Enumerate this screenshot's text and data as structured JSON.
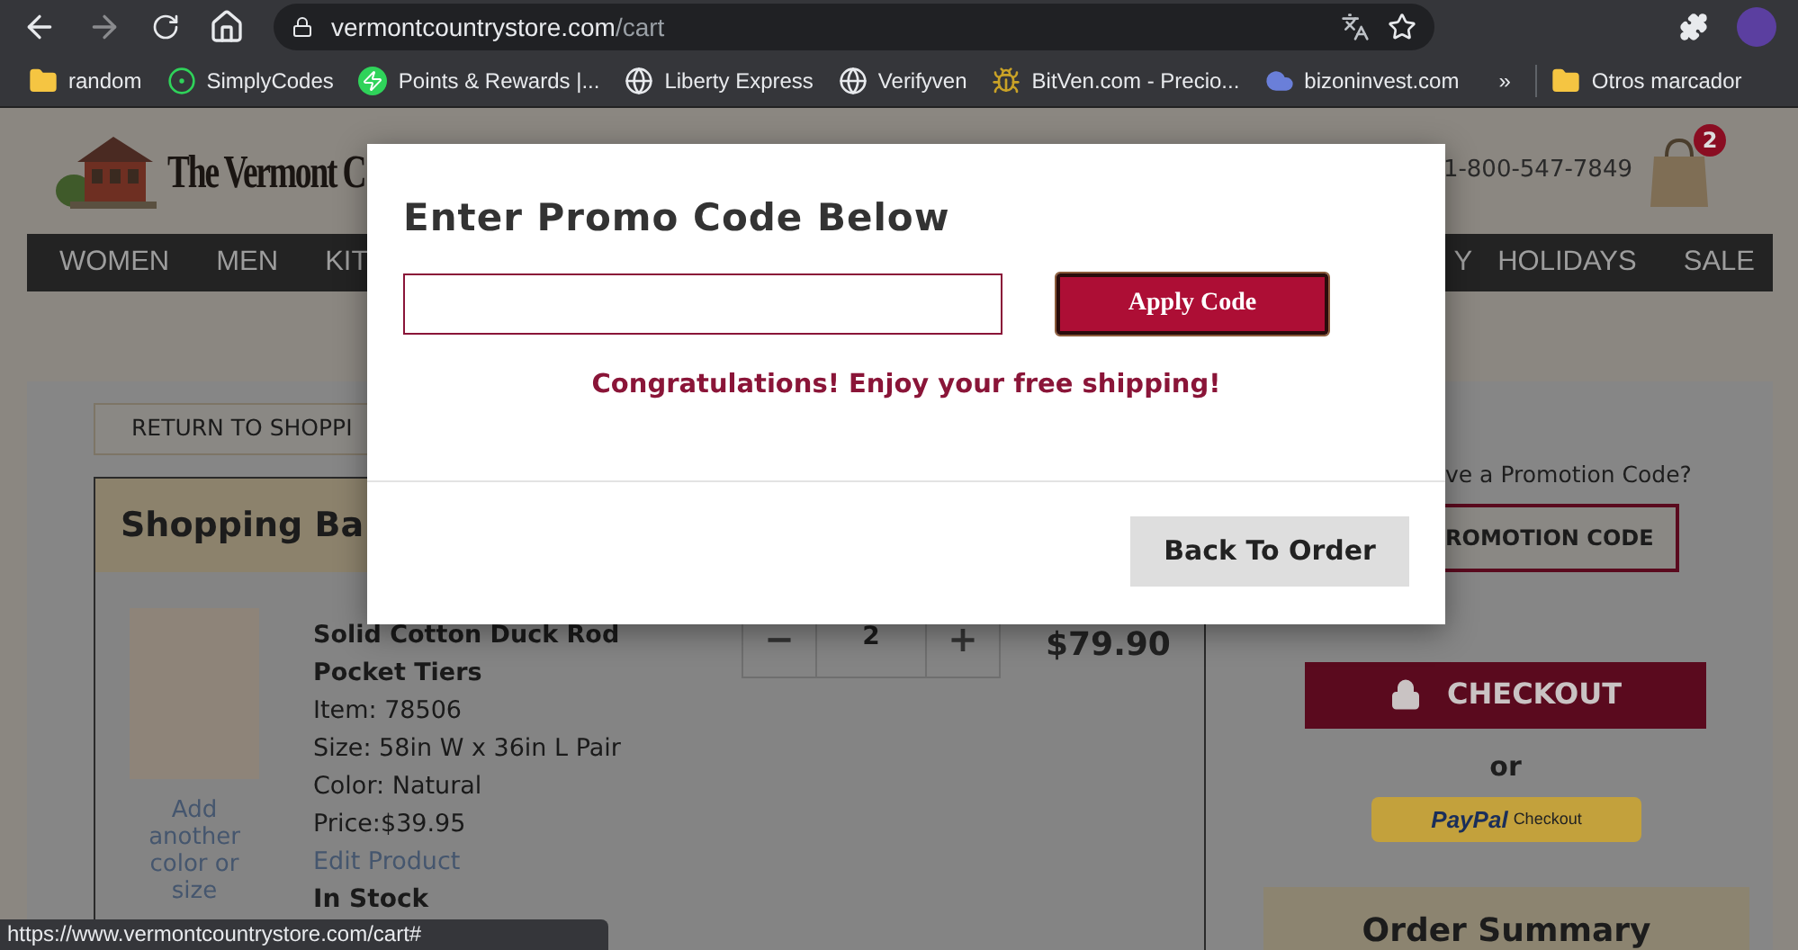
{
  "browser": {
    "url_host": "vermontcountrystore.com",
    "url_path": "/cart",
    "bookmarks": [
      {
        "kind": "folder",
        "label": "random"
      },
      {
        "kind": "ring",
        "label": "SimplyCodes"
      },
      {
        "kind": "bolt",
        "label": "Points & Rewards |..."
      },
      {
        "kind": "globe",
        "label": "Liberty Express"
      },
      {
        "kind": "globe",
        "label": "Verifyven"
      },
      {
        "kind": "bug",
        "label": "BitVen.com - Precio..."
      },
      {
        "kind": "cloud",
        "label": "bizoninvest.com"
      }
    ],
    "overflow": "»",
    "other_bookmarks": "Otros marcador"
  },
  "header": {
    "logo_text": "The Vermont C",
    "phone": "1-800-547-7849",
    "cart_count": "2"
  },
  "nav": [
    "WOMEN",
    "MEN",
    "KIT",
    "Y",
    "HOLIDAYS",
    "SALE"
  ],
  "cart": {
    "return_button": "RETURN TO SHOPPI",
    "title": "Shopping Ba",
    "item": {
      "add_link": "Add another color or size",
      "name_line_1": "Solid Cotton Duck Rod",
      "name_line_2": "Pocket Tiers",
      "details": [
        "Item: 78506",
        "Size: 58in W x 36in L Pair",
        "Color: Natural",
        "Price:$39.95"
      ],
      "edit_link": "Edit Product",
      "stock": "In Stock",
      "minus": "−",
      "quantity": "2",
      "plus": "+",
      "total": "$79.90"
    }
  },
  "sidebar": {
    "promo_question": "ve a Promotion Code?",
    "promo_button": "ROMOTION CODE",
    "checkout": "CHECKOUT",
    "or": "or",
    "paypal_brand": "PayPal",
    "paypal_label": "Checkout",
    "summary_title": "Order Summary"
  },
  "modal": {
    "title": "Enter Promo Code Below",
    "apply_button": "Apply Code",
    "message": "Congratulations! Enjoy your free shipping!",
    "back_button": "Back To Order"
  },
  "status_url": "https://www.vermontcountrystore.com/cart#"
}
